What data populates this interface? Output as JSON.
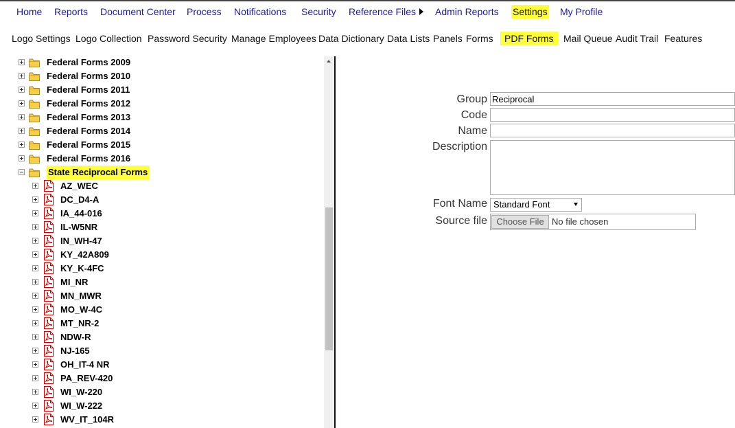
{
  "main_nav": [
    {
      "label": "Home"
    },
    {
      "label": "Reports"
    },
    {
      "label": "Document Center"
    },
    {
      "label": "Process"
    },
    {
      "label": "Notifications"
    },
    {
      "label": "Security"
    },
    {
      "label": "Reference Files"
    },
    {
      "label": "Admin Reports"
    },
    {
      "label": "Settings",
      "highlighted": true
    },
    {
      "label": "My Profile"
    }
  ],
  "sub_nav": [
    {
      "label": "Logo Settings"
    },
    {
      "label": "Logo Collection"
    },
    {
      "label": "Password Security"
    },
    {
      "label": "Manage Employees"
    },
    {
      "label": "Data Dictionary"
    },
    {
      "label": "Data Lists"
    },
    {
      "label": "Panels"
    },
    {
      "label": "Forms"
    },
    {
      "label": "PDF Forms",
      "highlighted": true
    },
    {
      "label": "Mail Queue"
    },
    {
      "label": "Audit Trail"
    },
    {
      "label": "Features"
    }
  ],
  "tree": {
    "folders": [
      {
        "label": "Federal Forms 2009"
      },
      {
        "label": "Federal Forms 2010"
      },
      {
        "label": "Federal Forms 2011"
      },
      {
        "label": "Federal Forms 2012"
      },
      {
        "label": "Federal Forms 2013"
      },
      {
        "label": "Federal Forms 2014"
      },
      {
        "label": "Federal Forms 2015"
      },
      {
        "label": "Federal Forms 2016"
      },
      {
        "label": "State Reciprocal Forms",
        "expanded": true,
        "highlighted": true
      }
    ],
    "forms": [
      {
        "label": "AZ_WEC"
      },
      {
        "label": "DC_D4-A"
      },
      {
        "label": "IA_44-016"
      },
      {
        "label": "IL-W5NR"
      },
      {
        "label": "IN_WH-47"
      },
      {
        "label": "KY_42A809"
      },
      {
        "label": "KY_K-4FC"
      },
      {
        "label": "MI_NR"
      },
      {
        "label": "MN_MWR"
      },
      {
        "label": "MO_W-4C"
      },
      {
        "label": "MT_NR-2"
      },
      {
        "label": "NDW-R"
      },
      {
        "label": "NJ-165"
      },
      {
        "label": "OH_IT-4 NR"
      },
      {
        "label": "PA_REV-420"
      },
      {
        "label": "WI_W-220"
      },
      {
        "label": "WI_W-222"
      },
      {
        "label": "WV_IT_104R"
      }
    ]
  },
  "form": {
    "group_label": "Group",
    "group_value": "Reciprocal",
    "code_label": "Code",
    "code_value": "",
    "name_label": "Name",
    "name_value": "",
    "description_label": "Description",
    "description_value": "",
    "font_name_label": "Font Name",
    "font_name_value": "Standard Font",
    "source_file_label": "Source file",
    "choose_file_label": "Choose File",
    "file_status": "No file chosen"
  },
  "colors": {
    "highlight": "#ffff38",
    "nav_link": "#1a1aa6",
    "folder": "#f5cf4a",
    "pdf_red": "#cc0000"
  },
  "icons": {
    "folder": "folder-icon",
    "pdf": "pdf-file-icon",
    "expand": "expand-toggle-icon",
    "submenu": "arrow-right-icon"
  }
}
